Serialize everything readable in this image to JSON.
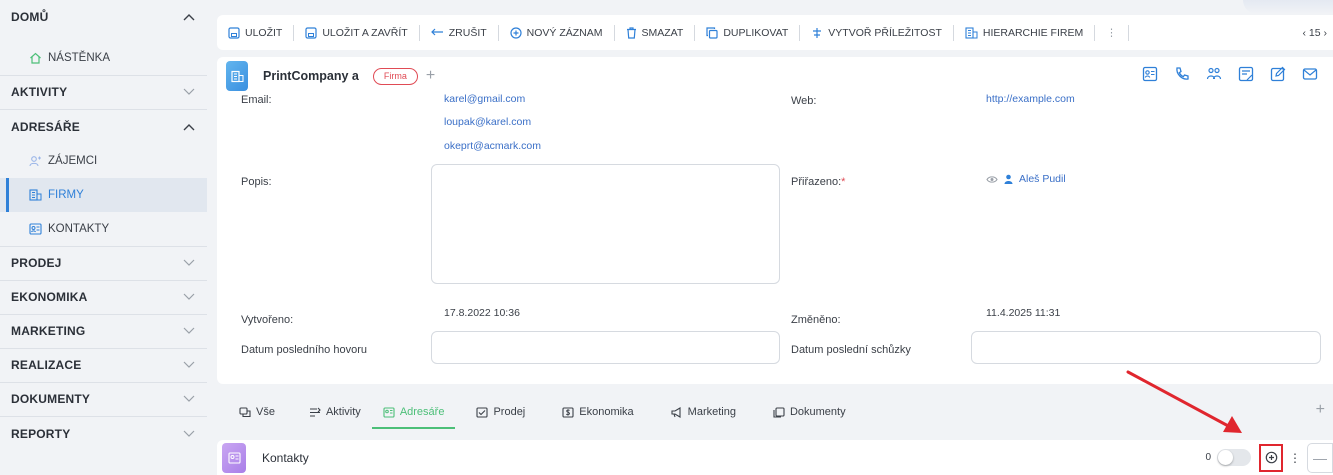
{
  "sidebar": {
    "sections": [
      {
        "label": "DOMŮ",
        "expanded": true
      },
      {
        "label": "AKTIVITY",
        "expanded": false
      },
      {
        "label": "ADRESÁŘE",
        "expanded": true
      },
      {
        "label": "PRODEJ",
        "expanded": false
      },
      {
        "label": "EKONOMIKA",
        "expanded": false
      },
      {
        "label": "MARKETING",
        "expanded": false
      },
      {
        "label": "REALIZACE",
        "expanded": false
      },
      {
        "label": "DOKUMENTY",
        "expanded": false
      },
      {
        "label": "REPORTY",
        "expanded": false
      }
    ],
    "items": {
      "nastenka": "NÁSTĚNKA",
      "zajemci": "ZÁJEMCI",
      "firmy": "FIRMY",
      "kontakty": "KONTAKTY"
    }
  },
  "toolbar": {
    "save": "ULOŽIT",
    "save_close": "ULOŽIT A ZAVŘÍT",
    "cancel": "ZRUŠIT",
    "new_record": "NOVÝ ZÁZNAM",
    "delete": "SMAZAT",
    "duplicate": "DUPLIKOVAT",
    "create_opportunity": "VYTVOŘ PŘÍLEŽITOST",
    "company_hierarchy": "HIERARCHIE FIREM",
    "more": "⋮",
    "pager": "‹ 15 ›"
  },
  "record": {
    "name": "PrintCompany a",
    "badge": "Firma",
    "add": "+"
  },
  "fields": {
    "email_label": "Email:",
    "emails": [
      "karel@gmail.com",
      "loupak@karel.com",
      "okeprt@acmark.com"
    ],
    "web_label": "Web:",
    "web_value": "http://example.com",
    "popis_label": "Popis:",
    "prirazeno_label": "Přiřazeno:",
    "prirazeno_required": "*",
    "prirazeno_value": "Aleš Pudil",
    "vytvoreno_label": "Vytvořeno:",
    "vytvoreno_value": "17.8.2022 10:36",
    "zmeneno_label": "Změněno:",
    "zmeneno_value": "11.4.2025 11:31",
    "last_call_label": "Datum posledního hovoru",
    "last_call_value": "",
    "last_meeting_label": "Datum poslední schůzky",
    "last_meeting_value": ""
  },
  "tabs": [
    {
      "label": "Vše",
      "icon": "chat-icon",
      "active": false
    },
    {
      "label": "Aktivity",
      "icon": "activity-icon",
      "active": false
    },
    {
      "label": "Adresáře",
      "icon": "contact-card-icon",
      "active": true
    },
    {
      "label": "Prodej",
      "icon": "checklist-icon",
      "active": false
    },
    {
      "label": "Ekonomika",
      "icon": "dollar-doc-icon",
      "active": false
    },
    {
      "label": "Marketing",
      "icon": "megaphone-icon",
      "active": false
    },
    {
      "label": "Dokumenty",
      "icon": "documents-icon",
      "active": false
    }
  ],
  "tabs_add": "+",
  "panel": {
    "title": "Kontakty",
    "count": "0",
    "kebab": "⋮",
    "minus": "—"
  },
  "colors": {
    "accent_blue": "#2f80d8",
    "accent_green": "#4cbf78",
    "badge_red": "#e04b55",
    "highlight_red": "#e0262e"
  }
}
